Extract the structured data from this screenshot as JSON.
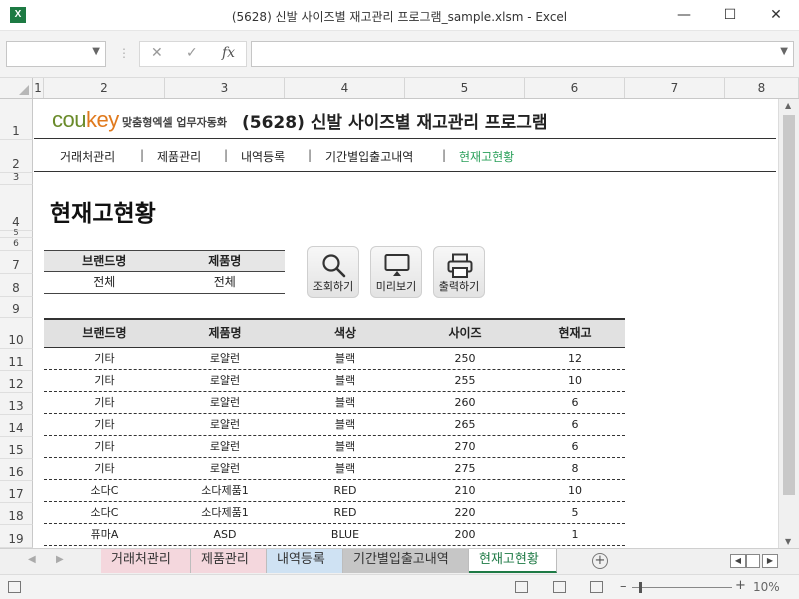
{
  "window": {
    "title": "(5628) 신발 사이즈별 재고관리 프로그램_sample.xlsm  -  Excel",
    "app_icon": "X"
  },
  "formula_bar": {
    "name_box": "",
    "formula": ""
  },
  "columns": [
    "1",
    "2",
    "3",
    "4",
    "5",
    "6",
    "7",
    "8"
  ],
  "rows": [
    "1",
    "2",
    "3",
    "4",
    "5",
    "6",
    "7",
    "8",
    "9",
    "10",
    "11",
    "12",
    "13",
    "14",
    "15",
    "16",
    "17",
    "18",
    "19"
  ],
  "header": {
    "logo_text_1": "cou",
    "logo_text_2": "key",
    "logo_sub": "맞춤형엑셀 업무자동화",
    "program_title": "(5628) 신발 사이즈별 재고관리 프로그램"
  },
  "nav": {
    "items": [
      "거래처관리",
      "제품관리",
      "내역등록",
      "기간별입출고내역",
      "현재고현황"
    ],
    "separator": "|",
    "active": "현재고현황"
  },
  "page_title": "현재고현황",
  "filter": {
    "headers": [
      "브랜드명",
      "제품명"
    ],
    "values": [
      "전체",
      "전체"
    ]
  },
  "buttons": {
    "search": "조회하기",
    "preview": "미리보기",
    "print": "출력하기"
  },
  "table": {
    "headers": [
      "브랜드명",
      "제품명",
      "색상",
      "사이즈",
      "현재고"
    ],
    "rows": [
      [
        "기타",
        "로얄런",
        "블랙",
        "250",
        "12"
      ],
      [
        "기타",
        "로얄런",
        "블랙",
        "255",
        "10"
      ],
      [
        "기타",
        "로얄런",
        "블랙",
        "260",
        "6"
      ],
      [
        "기타",
        "로얄런",
        "블랙",
        "265",
        "6"
      ],
      [
        "기타",
        "로얄런",
        "블랙",
        "270",
        "6"
      ],
      [
        "기타",
        "로얄런",
        "블랙",
        "275",
        "8"
      ],
      [
        "소다C",
        "소다제품1",
        "RED",
        "210",
        "10"
      ],
      [
        "소다C",
        "소다제품1",
        "RED",
        "220",
        "5"
      ],
      [
        "퓨마A",
        "ASD",
        "BLUE",
        "200",
        "1"
      ]
    ]
  },
  "sheet_tabs": [
    {
      "label": "거래처관리",
      "color": "#f4d7dd"
    },
    {
      "label": "제품관리",
      "color": "#f4d7dd"
    },
    {
      "label": "내역등록",
      "color": "#cfe2f3"
    },
    {
      "label": "기간별입출고내역",
      "color": "#c6c6c6"
    },
    {
      "label": "현재고현황",
      "color": "#ffffff"
    }
  ],
  "active_tab": "현재고현황",
  "status": {
    "zoom": "10%"
  },
  "colors": {
    "accent_green": "#2aa05a",
    "excel_green": "#1d7a43",
    "logo_green": "#6a8b2a",
    "logo_orange": "#e07a1e"
  }
}
